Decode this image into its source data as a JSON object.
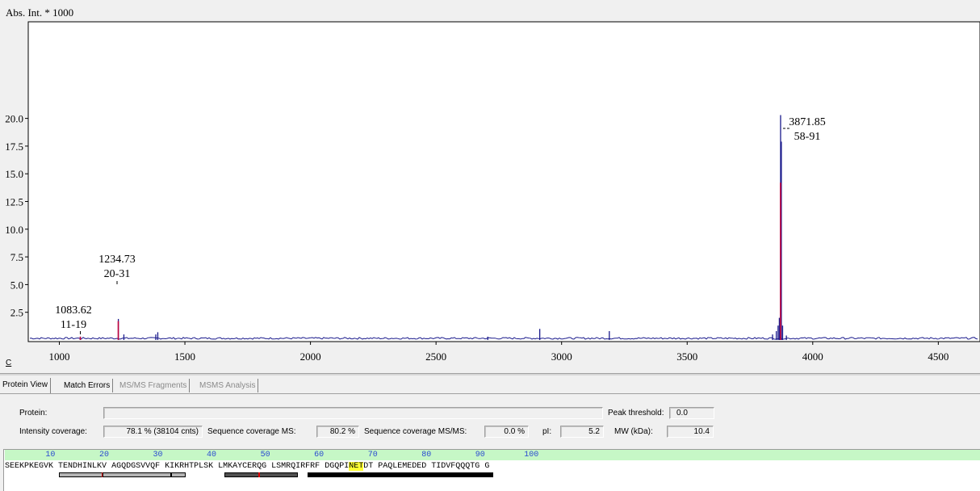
{
  "spectrum": {
    "y_axis_title": "Abs. Int. * 1000",
    "corner_button": "C",
    "peak_labels": [
      {
        "mass": "1083.62",
        "range": "11-19"
      },
      {
        "mass": "1234.73",
        "range": "20-31"
      },
      {
        "mass": "3871.85",
        "range": "58-91"
      }
    ],
    "colors": {
      "trace": "#1a1a8c",
      "matched_peak": "#c0003c",
      "plot_bg": "#ffffff",
      "panel_bg": "#f0f0f0"
    }
  },
  "chart_data": {
    "type": "line",
    "title": "",
    "xlabel": "",
    "ylabel": "Abs. Int. * 1000",
    "xlim": [
      890,
      4680
    ],
    "ylim": [
      0,
      22.5
    ],
    "x_ticks": [
      1000,
      1500,
      2000,
      2500,
      3000,
      3500,
      4000,
      4500
    ],
    "x_tick_labels": [
      "1000",
      "1500",
      "2000",
      "2500",
      "3000",
      "3500",
      "4000",
      "4500"
    ],
    "y_ticks": [
      2.5,
      5.0,
      7.5,
      10.0,
      12.5,
      15.0,
      17.5,
      20.0
    ],
    "y_tick_labels": [
      "2.5",
      "5.0",
      "7.5",
      "10.0",
      "12.5",
      "15.0",
      "17.5",
      "20.0"
    ],
    "series": [
      {
        "x": [
          1083.62,
          1235,
          1257,
          1384,
          1392,
          2706,
          2913,
          3190,
          3840,
          3855,
          3862,
          3867,
          3872,
          3875,
          3880,
          3895
        ],
        "values": [
          0.3,
          1.9,
          0.5,
          0.5,
          0.7,
          0.3,
          1.0,
          0.8,
          0.5,
          0.8,
          1.3,
          2.0,
          20.3,
          17.9,
          1.3,
          0.4
        ]
      }
    ],
    "matched_peaks": [
      {
        "x": 1083.62,
        "y": 0.3
      },
      {
        "x": 1234.73,
        "y": 1.7
      },
      {
        "x": 3871.85,
        "y": 14.2
      }
    ],
    "grid": false
  },
  "tabs": [
    {
      "label": "Protein View",
      "active": true
    },
    {
      "label": "Match Errors",
      "active": false,
      "enabled": true
    },
    {
      "label": "MS/MS Fragments",
      "active": false,
      "enabled": false
    },
    {
      "label": "MSMS Analysis",
      "active": false,
      "enabled": false
    }
  ],
  "protein_view": {
    "protein_label": "Protein:",
    "protein_value": "",
    "peak_threshold_label": "Peak threshold:",
    "peak_threshold_value": "0.0",
    "intensity_coverage_label": "Intensity coverage:",
    "intensity_coverage_value": "78.1 % (38104 cnts)",
    "seq_cov_ms_label": "Sequence coverage MS:",
    "seq_cov_ms_value": "80.2 %",
    "seq_cov_msms_label": "Sequence coverage MS/MS:",
    "seq_cov_msms_value": "0.0 %",
    "pi_label": "pI:",
    "pi_value": "5.2",
    "mw_label": "MW (kDa):",
    "mw_value": "10.4"
  },
  "sequence": {
    "ruler_ticks": [
      "10",
      "20",
      "30",
      "40",
      "50",
      "60",
      "70",
      "80",
      "90",
      "100"
    ],
    "blocks": [
      "SEEKPKEGVK",
      "TENDHINLKV",
      "AGQDGSVVQF",
      "KIKRHTPLSK",
      "LMKAYCERQG",
      "LSMRQIRFRF",
      "DGQPINETDT",
      "PAQLEMEDED",
      "TIDVFQQQTG",
      "G"
    ],
    "highlight": "NET",
    "highlight_block": 6,
    "highlight_offset": 5,
    "coverage_colors": {
      "partial": "#b4b4b4",
      "mid": "#505050",
      "full": "#000000",
      "mark": "#e00000"
    }
  }
}
